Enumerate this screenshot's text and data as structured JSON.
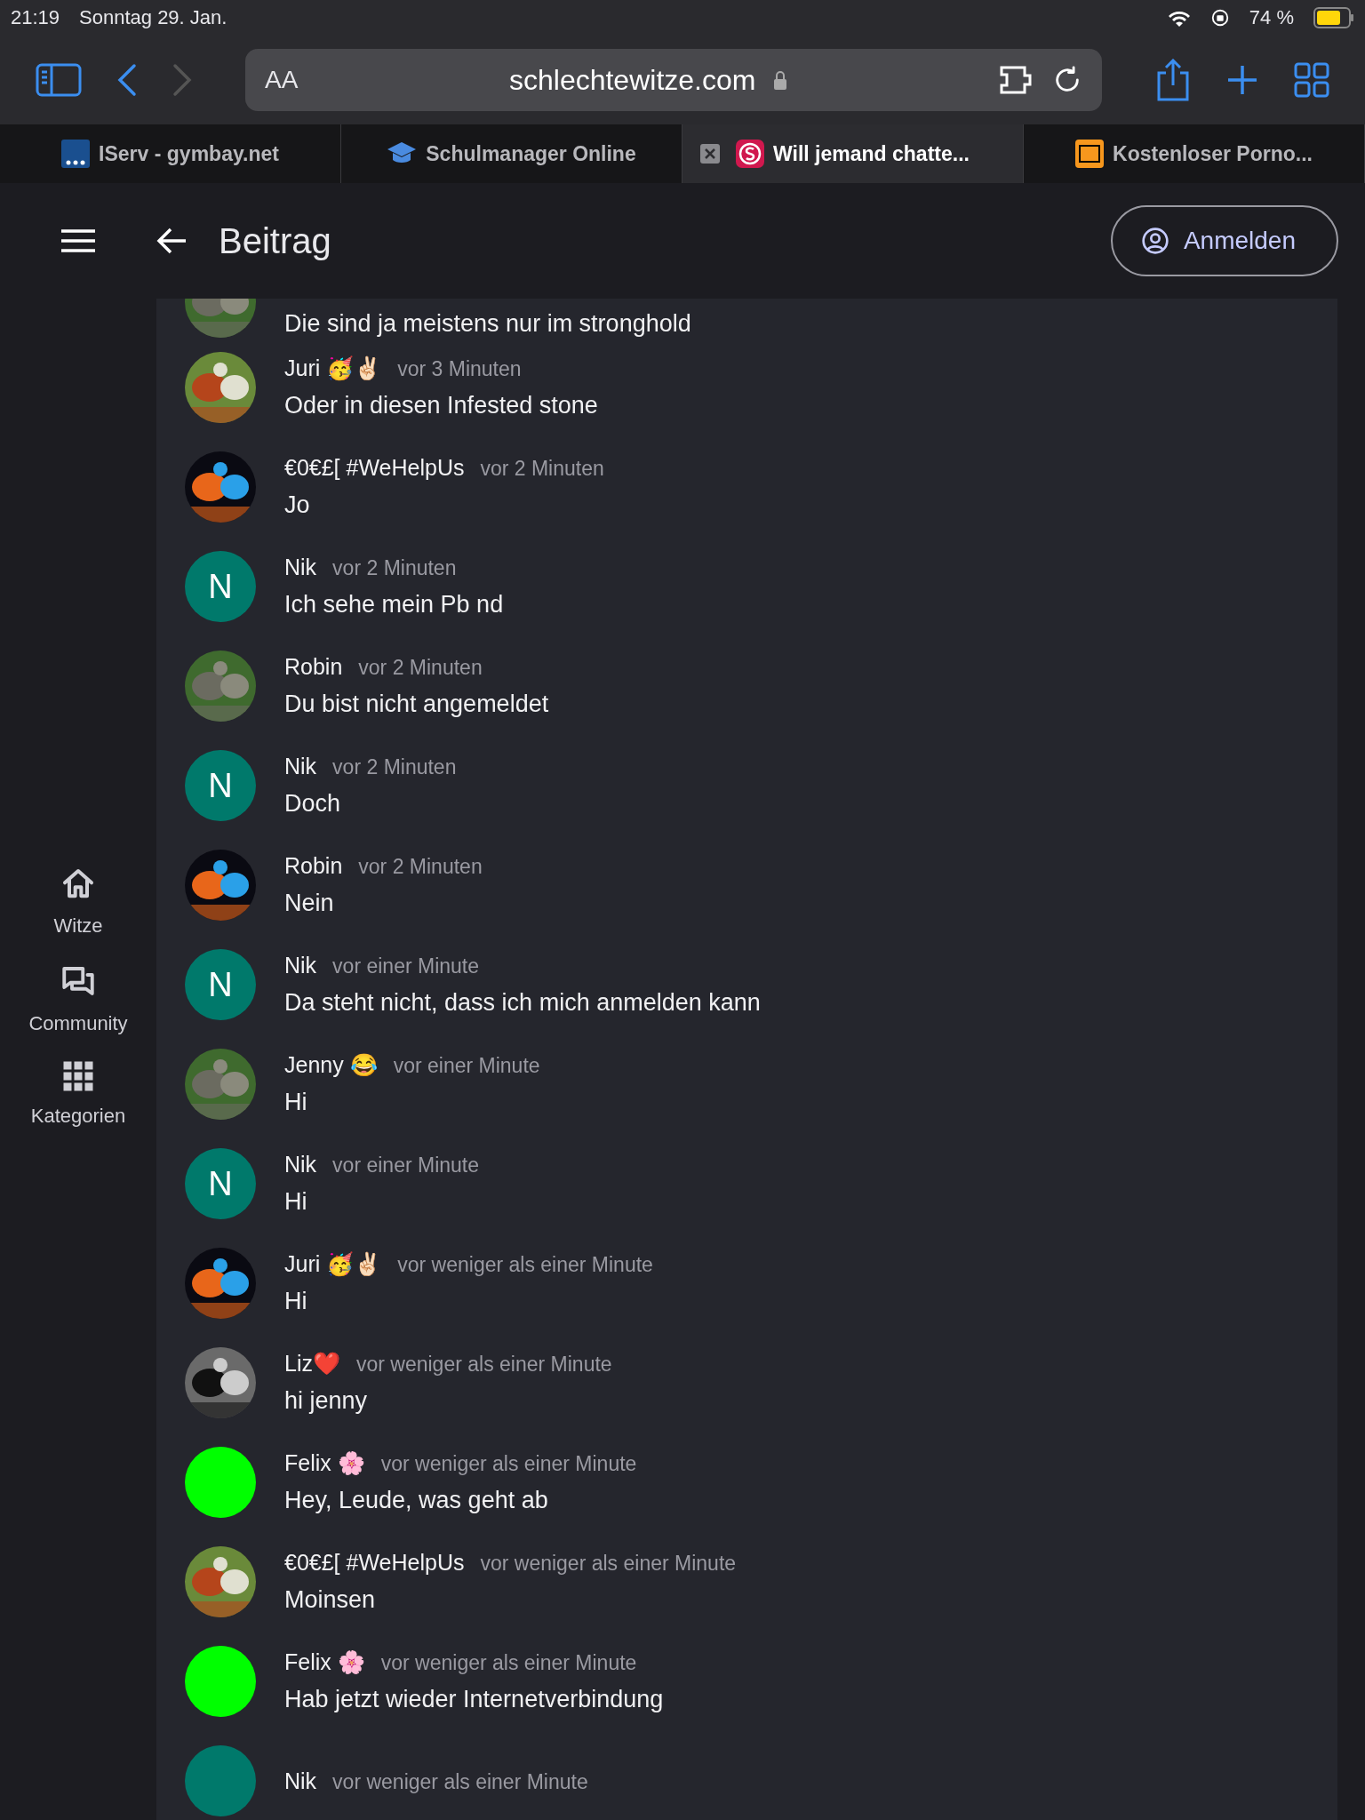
{
  "status_bar": {
    "time": "21:19",
    "date": "Sonntag 29. Jan.",
    "battery": "74 %"
  },
  "toolbar": {
    "text_size": "AA",
    "url": "schlechtewitze.com"
  },
  "tabs": [
    {
      "label": "IServ - gymbay.net",
      "selected": false
    },
    {
      "label": "Schulmanager Online",
      "selected": false
    },
    {
      "label": "Will jemand chatte...",
      "selected": true
    },
    {
      "label": "Kostenloser Porno...",
      "selected": false
    }
  ],
  "header": {
    "title": "Beitrag",
    "login": "Anmelden"
  },
  "sidebar": {
    "items": [
      {
        "label": "Witze"
      },
      {
        "label": "Community"
      },
      {
        "label": "Kategorien"
      }
    ]
  },
  "comments": [
    {
      "text": "Die sind ja meistens nur im stronghold"
    },
    {
      "author": "Juri 🥳✌🏻",
      "time": "vor 3 Minuten",
      "text": "Oder in diesen Infested stone"
    },
    {
      "author": "€0€£[ #WeHelpUs",
      "time": "vor 2 Minuten",
      "text": "Jo"
    },
    {
      "author": "Nik",
      "time": "vor 2 Minuten",
      "text": "Ich sehe mein Pb nd",
      "avatar": {
        "kind": "letter",
        "letter": "N",
        "color": "#00796b"
      }
    },
    {
      "author": "Robin",
      "time": "vor 2 Minuten",
      "text": "Du bist nicht angemeldet"
    },
    {
      "author": "Nik",
      "time": "vor 2 Minuten",
      "text": "Doch",
      "avatar": {
        "kind": "letter",
        "letter": "N",
        "color": "#00796b"
      }
    },
    {
      "author": "Robin",
      "time": "vor 2 Minuten",
      "text": "Nein"
    },
    {
      "author": "Nik",
      "time": "vor einer Minute",
      "text": "Da steht nicht, dass ich mich anmelden kann",
      "avatar": {
        "kind": "letter",
        "letter": "N",
        "color": "#00796b"
      }
    },
    {
      "author": "Jenny 😂",
      "time": "vor einer Minute",
      "text": "Hi"
    },
    {
      "author": "Nik",
      "time": "vor einer Minute",
      "text": "Hi",
      "avatar": {
        "kind": "letter",
        "letter": "N",
        "color": "#00796b"
      }
    },
    {
      "author": "Juri 🥳✌🏻",
      "time": "vor weniger als einer Minute",
      "text": "Hi"
    },
    {
      "author": "Liz❤️",
      "time": "vor weniger als einer Minute",
      "text": "hi jenny"
    },
    {
      "author": "Felix 🌸",
      "time": "vor weniger als einer Minute",
      "text": "Hey, Leude, was geht ab",
      "avatar": {
        "kind": "color",
        "color": "#00ff00"
      }
    },
    {
      "author": "€0€£[ #WeHelpUs",
      "time": "vor weniger als einer Minute",
      "text": "Moinsen"
    },
    {
      "author": "Felix 🌸",
      "time": "vor weniger als einer Minute",
      "text": "Hab jetzt wieder Internetverbindung",
      "avatar": {
        "kind": "color",
        "color": "#00ff00"
      }
    },
    {
      "author": "Nik",
      "time": "vor weniger als einer Minute",
      "avatar": {
        "kind": "color",
        "color": "#00796b"
      }
    }
  ]
}
